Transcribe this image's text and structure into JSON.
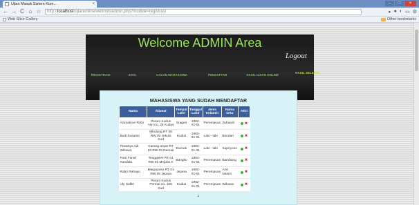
{
  "browser": {
    "tab_title": "Ujian Masuk Sistem Kom...",
    "tab_close": "×",
    "url_prefix": "http://",
    "url_host": "localhost",
    "url_path": "/ujianonline/webmin/admin.php?module=registrasi",
    "bookmark": "Web Slice Gallery",
    "other_bookmarks": "Other bookmarks",
    "back": "←",
    "forward": "→",
    "reload": "C",
    "home": "⌂",
    "star": "☆"
  },
  "header": {
    "welcome": "Welcome ADMIN Area",
    "logout": "Logout"
  },
  "menu": [
    "REGISTRASI",
    "SOAL",
    "CALON MAHASISWA",
    "PENDAFTAR",
    "HASIL UJIAN ONLINE",
    "HASIL SELEKSI"
  ],
  "main": {
    "title": "MAHASISWA YANG SUDAH MENDAFTAR",
    "columns": [
      "Nama",
      "Alamat",
      "Tempat Lahir",
      "Tanggal Lahir",
      "Jenis Kelamin",
      "Nama Ortu",
      "Aksi"
    ],
    "rows": [
      [
        "Azimatinur Rizki",
        "Perum Kudus Asri no. 26 Kudus",
        "Sragen",
        "1992-01-01",
        "Perempuan",
        "Zubaedi"
      ],
      [
        "Budi Susanto",
        "Mbulung RT 08 RW 02 Jekulo Kud",
        "Kudus",
        "1992-01-01",
        "Laki - laki",
        "Bondan"
      ],
      [
        "Prasetyo Adi Wibowo",
        "Karang anyar RT 03 RW 03 Demak",
        "Demak",
        "1992-01-01",
        "Laki - laki",
        "Supriyono"
      ],
      [
        "Putri Farah Kandida",
        "Tenggeles RT 01 RW 01 Mejobo K",
        "Bangko",
        "1992-01-01",
        "Perempuan",
        "Bambang"
      ],
      [
        "Rabri Rahayu",
        "Margoyoso RT 01 RW 05 Jepara",
        "Jepara",
        "1992-01-01",
        "Perempuan",
        "Aziz Nasrin"
      ],
      [
        "Uly Safitri",
        "Perum Kudus Permai no. 165 Kud",
        "Kudus",
        "1992-01-01",
        "Perempuan",
        "Wibowo"
      ]
    ],
    "page": "1"
  },
  "colors": {
    "header_text": "#9ee65a",
    "menu_text": "#7ed24a",
    "table_header": "#3c5f9c",
    "content_bg": "#d7f3f7"
  }
}
